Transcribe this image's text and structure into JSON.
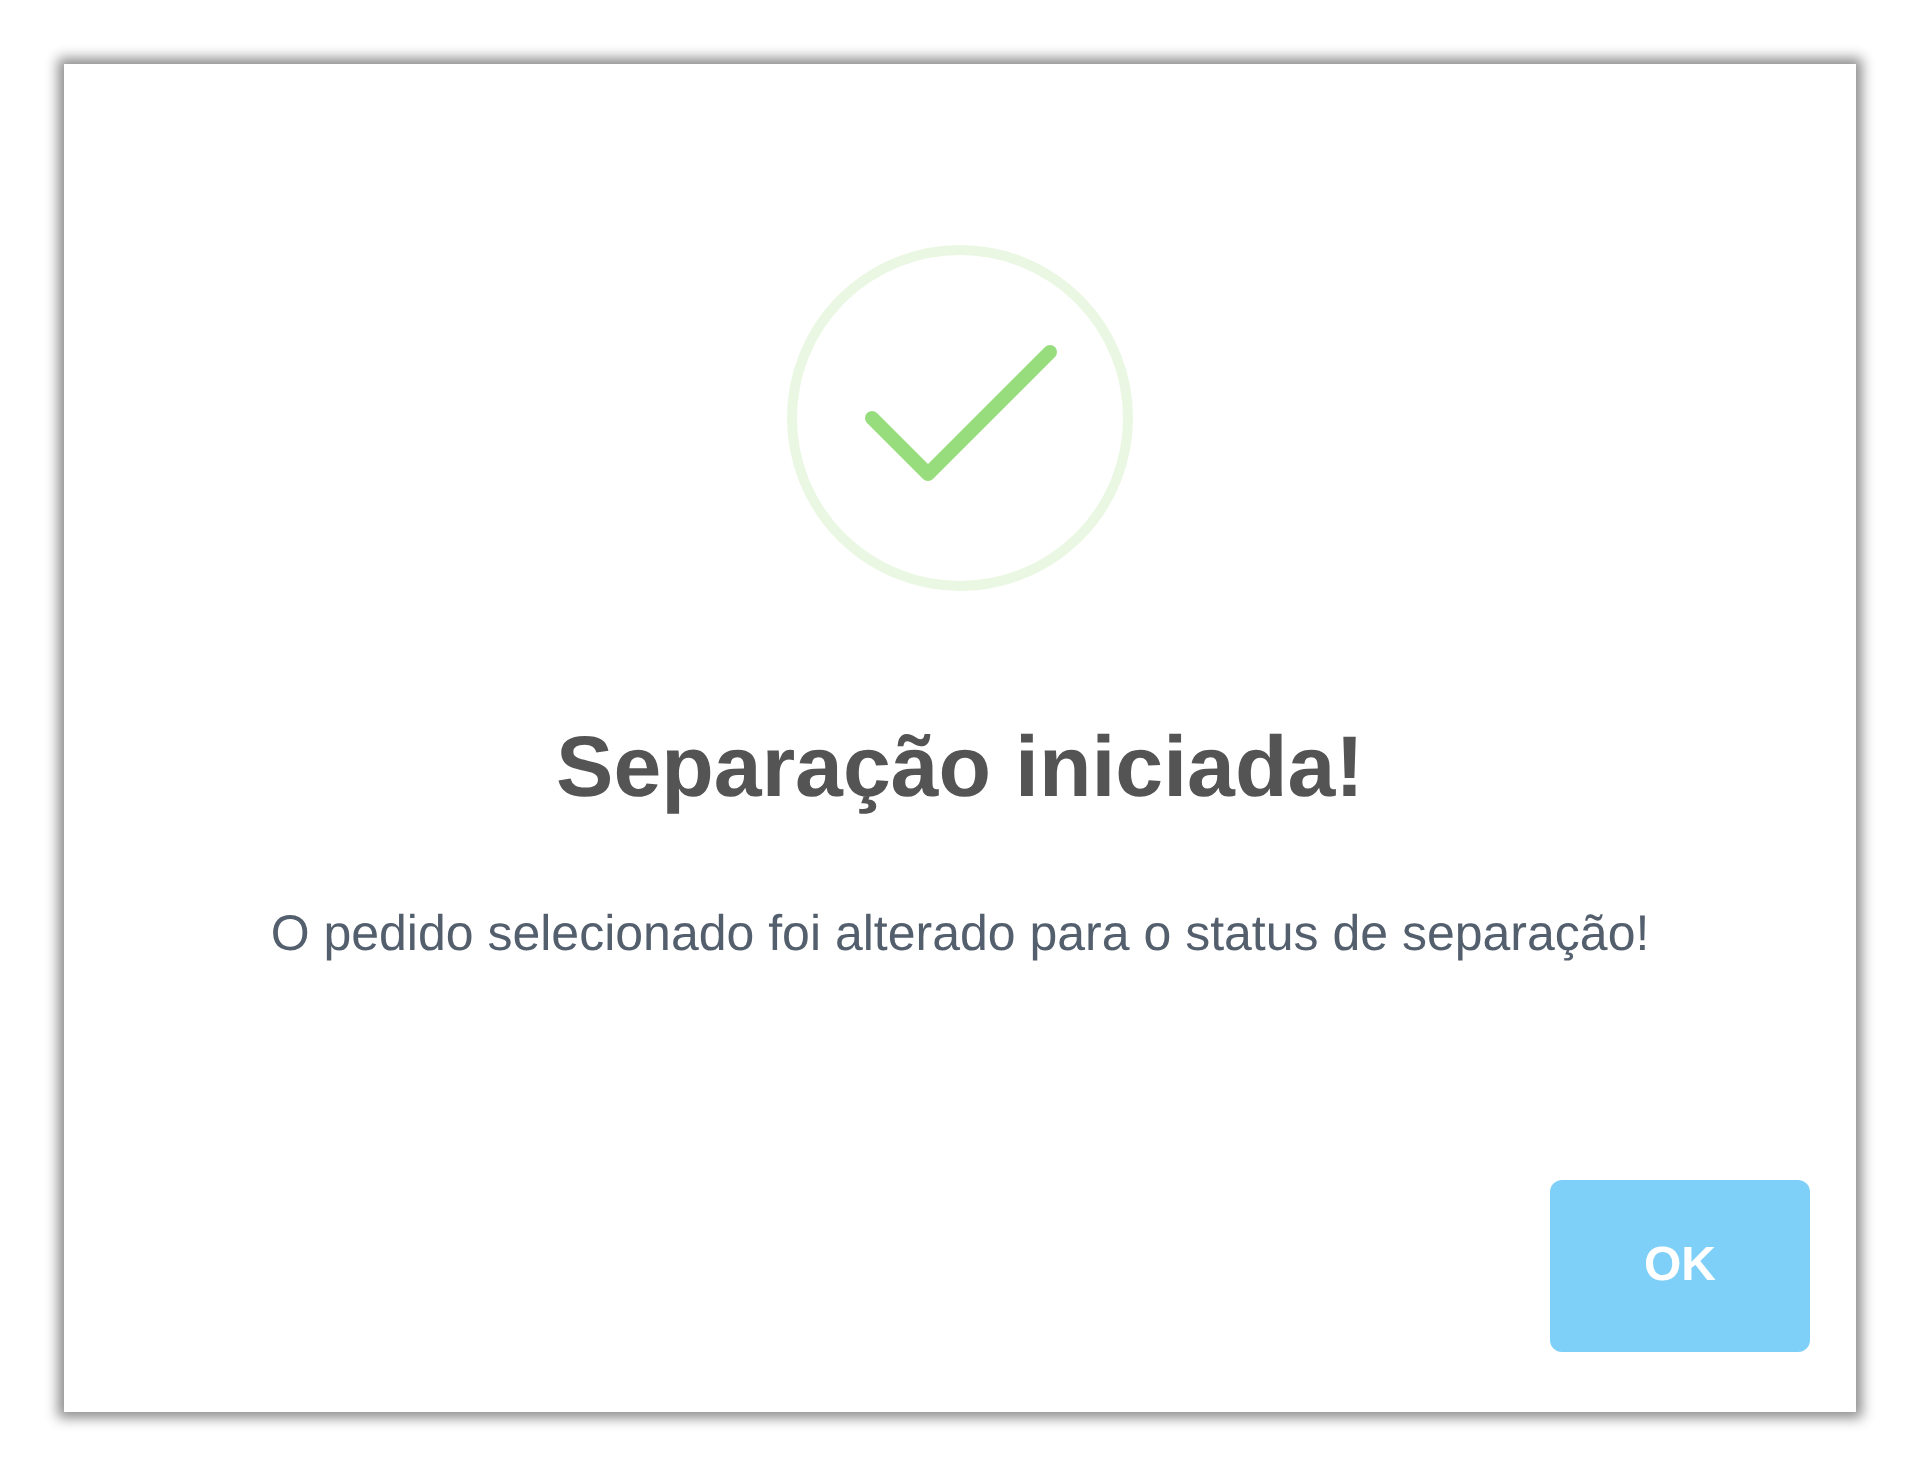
{
  "dialog": {
    "icon": {
      "kind": "success"
    },
    "title": "Separação iniciada!",
    "message": "O pedido selecionado foi alterado para o status de separação!",
    "buttons": [
      {
        "label": "OK",
        "kind": "confirm"
      }
    ]
  }
}
